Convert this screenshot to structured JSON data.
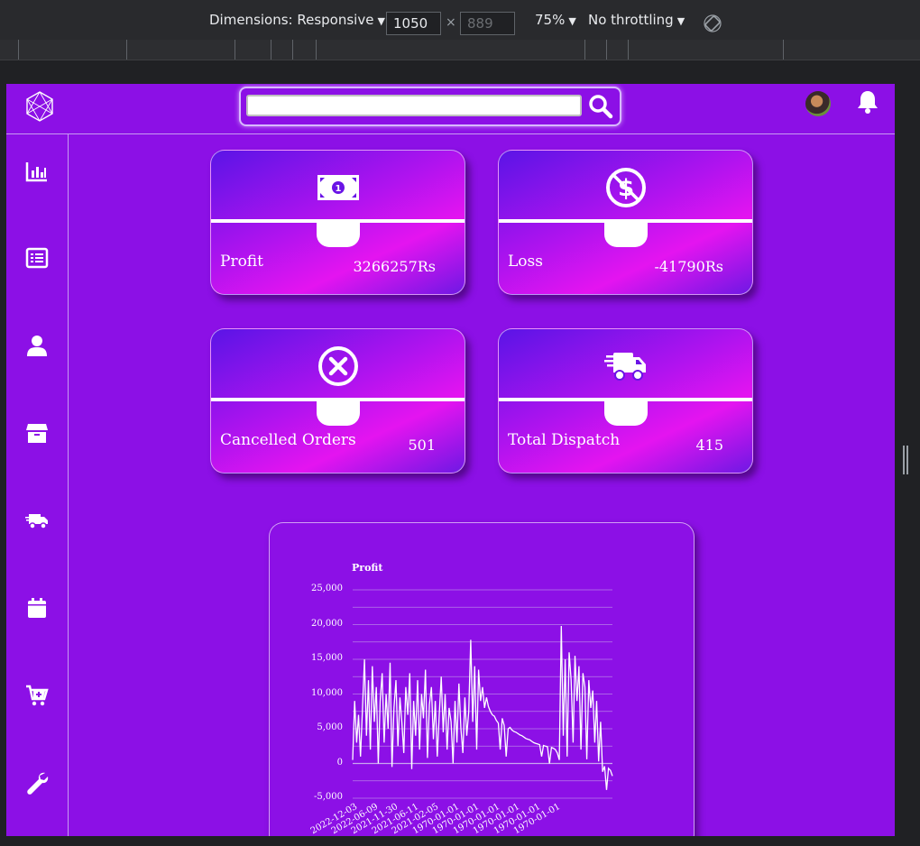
{
  "devtools": {
    "dimensions_label": "Dimensions: Responsive",
    "width": "1050",
    "times": "×",
    "height_placeholder": "889",
    "zoom": "75%",
    "throttling": "No throttling"
  },
  "header": {
    "search_placeholder": ""
  },
  "sidebar": {
    "items": [
      "chart-bar-icon",
      "list-icon",
      "user-icon",
      "box-icon",
      "truck-icon",
      "calendar-icon",
      "cart-plus-icon",
      "wrench-icon"
    ]
  },
  "cards": [
    {
      "label": "Profit",
      "value": "3266257Rs",
      "icon": "money-bill-icon"
    },
    {
      "label": "Loss",
      "value": "-41790Rs",
      "icon": "no-dollar-icon"
    },
    {
      "label": "Cancelled Orders",
      "value": "501",
      "icon": "circle-x-icon"
    },
    {
      "label": "Total Dispatch",
      "value": "415",
      "icon": "shipping-fast-icon"
    }
  ],
  "colors": {
    "background": "#8c10e6",
    "accent": "#e414f0"
  },
  "chart_data": {
    "type": "line",
    "title": "Profit",
    "xlabel": "",
    "ylabel": "",
    "ylim": [
      -5000,
      25000
    ],
    "y_ticks": [
      "25,000",
      "20,000",
      "15,000",
      "10,000",
      "5,000",
      "0",
      "-5,000"
    ],
    "x_ticks": [
      "2022-12-03",
      "2022-06-09",
      "2021-11-30",
      "2021-06-11",
      "2021-02-05",
      "1970-01-01",
      "1970-01-01",
      "1970-01-01",
      "1970-01-01",
      "1970-01-01",
      "1970-01-01"
    ],
    "grid": true,
    "series": [
      {
        "values": [
          500,
          9000,
          3000,
          7000,
          1000,
          8000,
          15000,
          4000,
          12000,
          2000,
          14000,
          6000,
          11000,
          0,
          9000,
          13000,
          3000,
          10000,
          5000,
          14500,
          -500,
          8000,
          12000,
          2500,
          9500,
          6000,
          1500,
          11000,
          7000,
          13000,
          -800,
          9000,
          4000,
          12000,
          2000,
          10000,
          6500,
          13500,
          800,
          8500,
          11000,
          3500,
          9000,
          1000,
          7000,
          12500,
          4500,
          10000,
          2000,
          8000,
          6000,
          0,
          9000,
          3000,
          11500,
          5000,
          1500,
          9500,
          4000,
          7500,
          17800,
          6000,
          14000,
          2000,
          13500,
          9000,
          11000,
          8000,
          9500,
          8200,
          7500,
          7000,
          6800,
          6200,
          5800,
          2000,
          6500,
          5500,
          1000,
          5000,
          5200,
          4800,
          4600,
          4500,
          4300,
          4100,
          4000,
          3800,
          3600,
          3500,
          3400,
          3200,
          3000,
          2900,
          2800,
          2700,
          1000,
          2600,
          2500,
          2400,
          0,
          2300,
          2200,
          2000,
          1500,
          500,
          19800,
          4000,
          15000,
          1000,
          16000,
          12000,
          3000,
          15500,
          9000,
          14000,
          2000,
          13000,
          11000,
          600,
          12000,
          8000,
          10500,
          3000,
          9000,
          300,
          6000,
          -1200,
          -400,
          -3800,
          -700,
          -1000,
          -1800
        ]
      }
    ]
  }
}
